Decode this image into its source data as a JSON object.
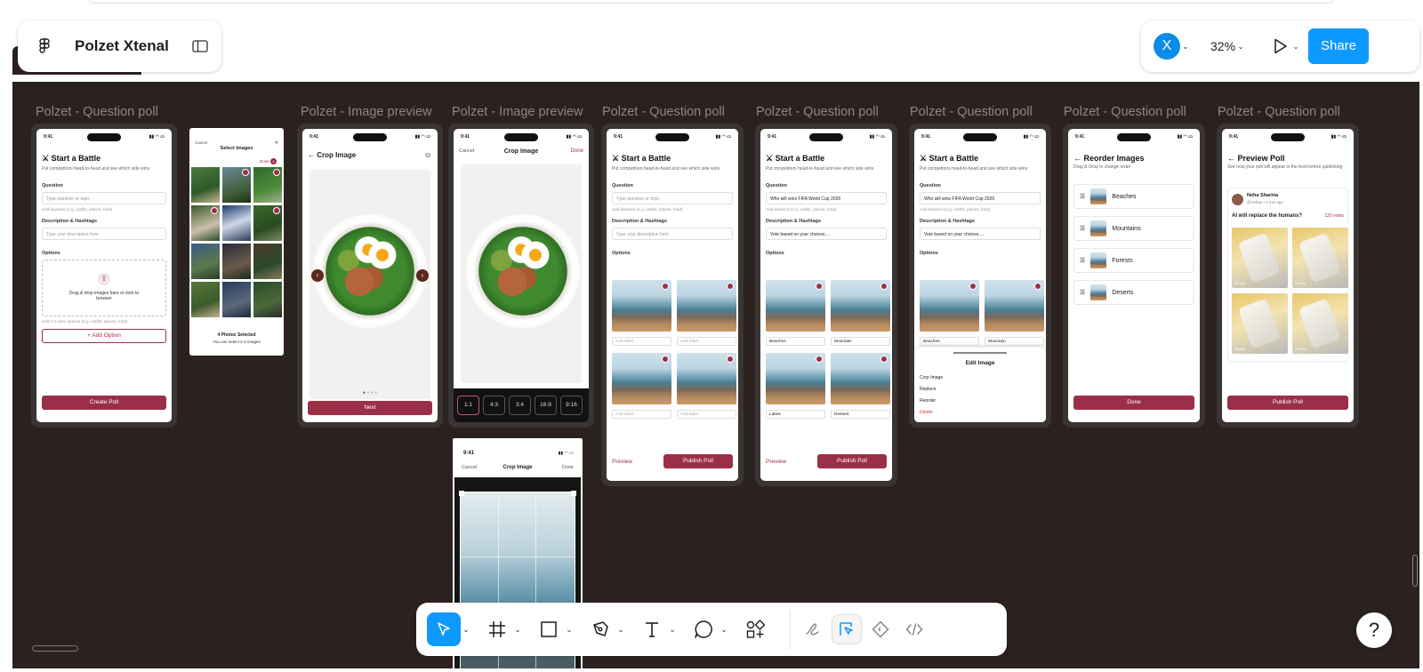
{
  "app": {
    "file_name": "Polzet Xtenal",
    "avatar_letter": "X",
    "zoom": "32%",
    "share_label": "Share",
    "help_label": "?"
  },
  "frames": [
    {
      "label": "Polzet - Question poll"
    },
    {
      "label": "Polzet - Image preview"
    },
    {
      "label": "Polzet - Image preview"
    },
    {
      "label": "Polzet - Question poll"
    },
    {
      "label": "Polzet - Question poll"
    },
    {
      "label": "Polzet - Question poll"
    },
    {
      "label": "Polzet - Question poll"
    },
    {
      "label": "Polzet - Question poll"
    }
  ],
  "status_time": "9:41",
  "battle": {
    "title": "⚔ Start a Battle",
    "subtitle": "Put competitors head-to-head and see which side wins",
    "question_label": "Question",
    "question_placeholder": "Type question or topic",
    "question_value": "Who will wins FIFA World Cup 2026",
    "keyword_hint": "Add keyword (e.g. outfits, places, food)",
    "desc_label": "Description & Hashtags",
    "desc_placeholder": "Type your description here",
    "desc_value": "Vote based on your choices....",
    "options_label": "Options",
    "upload_text": "Drag & drop images here or click to browser",
    "options_hint": "Add 2-4 clear options (e.g. outfits, places, food)",
    "add_option": "+ Add Option",
    "create_poll": "Create Poll",
    "add_label": "Add label",
    "preview": "Preview",
    "publish": "Publish Poll",
    "opt_beaches": "Beaches",
    "opt_mountain": "Mountain",
    "opt_lakes": "Lakes",
    "opt_dessert": "Dessert"
  },
  "select_images": {
    "cancel": "Cancel",
    "title": "Select Images",
    "done": "Done",
    "count_badge": "4",
    "selected_title": "4 Photos Selected",
    "selected_sub": "You can select 2-4 images"
  },
  "crop": {
    "title": "Crop Image",
    "cancel": "Cancel",
    "done": "Done",
    "next": "Next",
    "ratios": [
      "1:1",
      "4:3",
      "3:4",
      "16:9",
      "9:16"
    ]
  },
  "edit_sheet": {
    "title": "Edit Image",
    "items": [
      "Crop Image",
      "Replace",
      "Reorder",
      "Delete"
    ]
  },
  "reorder": {
    "title": "← Reorder Images",
    "subtitle": "Drag & Drop to change order",
    "items": [
      "Beaches",
      "Mountains",
      "Forests",
      "Deserts"
    ],
    "done": "Done"
  },
  "preview_poll": {
    "title": "← Preview Poll",
    "subtitle": "See how your poll will appear in the feed before publishing",
    "user_name": "Neha Sharma",
    "user_meta": "@nehap • 2 min ago",
    "question": "AI will replace the humans?",
    "votes": "120 votes",
    "publish": "Publish Poll",
    "badges": [
      "iPhone",
      "iPhone",
      "iPhone",
      "iPhone"
    ]
  },
  "colors": {
    "canvas": "#2b2220",
    "accent": "#9b2f48",
    "share": "#0d99ff",
    "avatar": "#0c8ce9"
  },
  "toolbar_tools": [
    "move-tool",
    "frame-tool",
    "rectangle-tool",
    "pen-tool",
    "text-tool",
    "comment-tool",
    "actions-tool"
  ],
  "mode_tools": [
    "draw-mode",
    "design-mode",
    "dev-mode",
    "code-mode"
  ]
}
